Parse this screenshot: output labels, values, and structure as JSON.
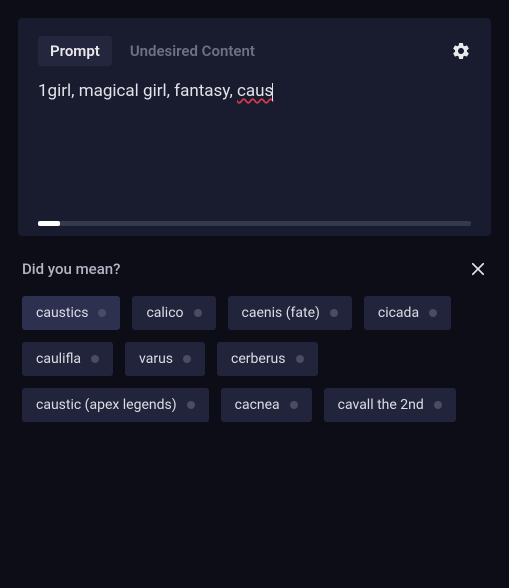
{
  "tabs": {
    "prompt": "Prompt",
    "undesired": "Undesired Content",
    "active": "prompt"
  },
  "prompt": {
    "value_prefix": "1girl, magical girl, fantasy, ",
    "value_squiggly": "caus"
  },
  "progress": {
    "percent": 5
  },
  "suggestions": {
    "title": "Did you mean?",
    "items": [
      {
        "label": "caustics",
        "highlight": true
      },
      {
        "label": "calico",
        "highlight": false
      },
      {
        "label": "caenis (fate)",
        "highlight": false
      },
      {
        "label": "cicada",
        "highlight": false
      },
      {
        "label": "caulifla",
        "highlight": false
      },
      {
        "label": "varus",
        "highlight": false
      },
      {
        "label": "cerberus",
        "highlight": false
      },
      {
        "label": "caustic (apex legends)",
        "highlight": false
      },
      {
        "label": "cacnea",
        "highlight": false
      },
      {
        "label": "cavall the 2nd",
        "highlight": false
      }
    ]
  }
}
